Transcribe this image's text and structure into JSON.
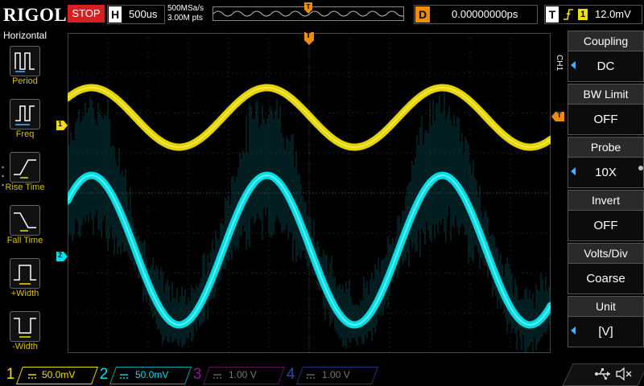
{
  "topbar": {
    "brand": "RIGOL",
    "run_status": "STOP",
    "horizontal_letter": "H",
    "timebase": "500us",
    "sample_rate": "500MSa/s",
    "memory_depth": "3.00M pts",
    "delay_letter": "D",
    "delay_value": "0.00000000ps",
    "trigger_letter": "T",
    "trigger_source": "1",
    "trigger_level": "12.0mV"
  },
  "leftbar": {
    "title": "Horizontal",
    "items": [
      {
        "label": "Period",
        "icon": "period-icon"
      },
      {
        "label": "Freq",
        "icon": "frequency-icon"
      },
      {
        "label": "Rise Time",
        "icon": "rise-time-icon"
      },
      {
        "label": "Fall Time",
        "icon": "fall-time-icon"
      },
      {
        "label": "+Width",
        "icon": "positive-width-icon"
      },
      {
        "label": "-Width",
        "icon": "negative-width-icon"
      }
    ]
  },
  "screen": {
    "ch1_marker": "1",
    "ch2_marker": "2",
    "trigger_marker": "T",
    "trigger_level_marker": "T"
  },
  "rightpanel": {
    "channel_tag": "CH1",
    "items": [
      {
        "head": "Coupling",
        "value": "DC"
      },
      {
        "head": "BW Limit",
        "value": "OFF"
      },
      {
        "head": "Probe",
        "value": "10X"
      },
      {
        "head": "Invert",
        "value": "OFF"
      },
      {
        "head": "Volts/Div",
        "value": "Coarse"
      },
      {
        "head": "Unit",
        "value": "[V]"
      }
    ]
  },
  "bottombar": {
    "channels": [
      {
        "num": "1",
        "scale": "50.0mV",
        "color": "#f0e000"
      },
      {
        "num": "2",
        "scale": "50.0mV",
        "color": "#00e0e8"
      },
      {
        "num": "3",
        "scale": "1.00 V",
        "color": "#c000c0"
      },
      {
        "num": "4",
        "scale": "1.00 V",
        "color": "#2060e0"
      }
    ]
  },
  "colors": {
    "ch1": "#f0e000",
    "ch2": "#00e6ee",
    "trigger": "#f08c00",
    "stop": "#d81e1e"
  }
}
